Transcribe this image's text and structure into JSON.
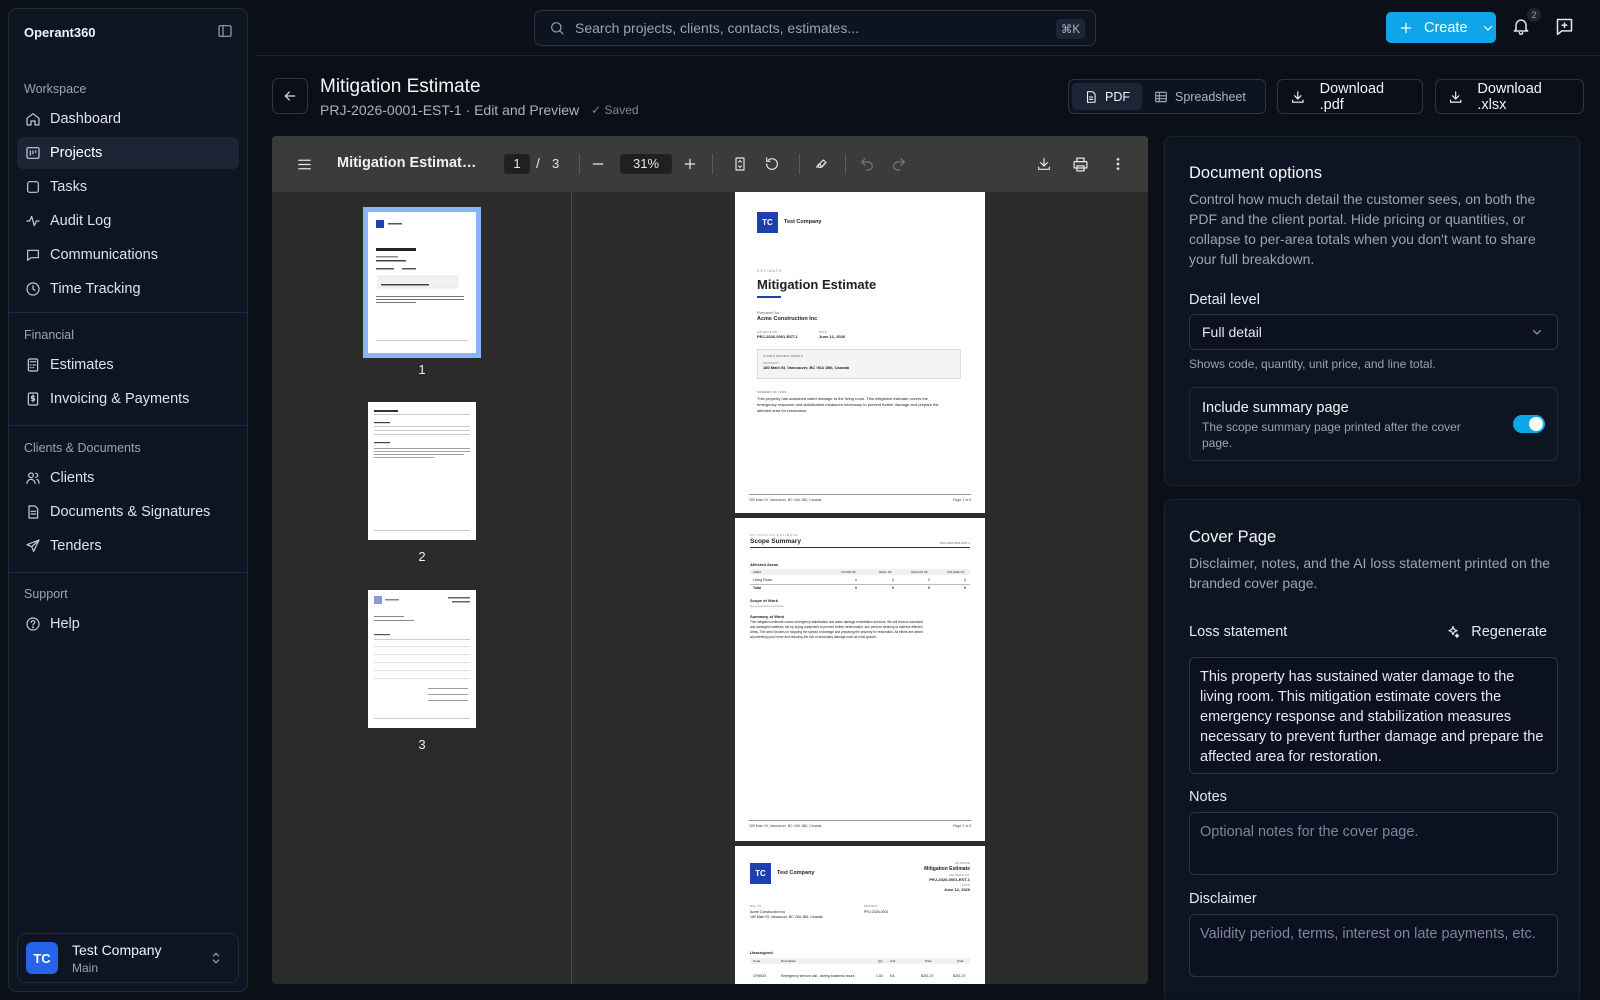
{
  "brand": "Operant360",
  "sidebar": {
    "groups": [
      {
        "title": "Workspace",
        "items": [
          {
            "label": "Dashboard",
            "icon": "home-icon"
          },
          {
            "label": "Projects",
            "icon": "projects-icon",
            "active": true
          },
          {
            "label": "Tasks",
            "icon": "tasks-icon"
          },
          {
            "label": "Audit Log",
            "icon": "activity-icon"
          },
          {
            "label": "Communications",
            "icon": "message-icon"
          },
          {
            "label": "Time Tracking",
            "icon": "clock-icon"
          }
        ]
      },
      {
        "title": "Financial",
        "items": [
          {
            "label": "Estimates",
            "icon": "calculator-icon"
          },
          {
            "label": "Invoicing & Payments",
            "icon": "receipt-icon"
          }
        ]
      },
      {
        "title": "Clients & Documents",
        "items": [
          {
            "label": "Clients",
            "icon": "users-icon"
          },
          {
            "label": "Documents & Signatures",
            "icon": "document-icon"
          },
          {
            "label": "Tenders",
            "icon": "send-icon"
          }
        ]
      },
      {
        "title": "Support",
        "items": [
          {
            "label": "Help",
            "icon": "help-icon"
          }
        ]
      }
    ],
    "user": {
      "initials": "TC",
      "name": "Test Company",
      "sub": "Main"
    }
  },
  "topbar": {
    "search_placeholder": "Search projects, clients, contacts, estimates...",
    "shortcut": "⌘K",
    "create_label": "Create",
    "notification_count": "2"
  },
  "header": {
    "title": "Mitigation Estimate",
    "subtitle": "PRJ-2026-0001-EST-1 · Edit and Preview",
    "saved": "Saved",
    "view_toggle": {
      "pdf": "PDF",
      "spreadsheet": "Spreadsheet"
    },
    "download_pdf": "Download .pdf",
    "download_xlsx": "Download .xlsx"
  },
  "viewer": {
    "doc_title": "Mitigation Estimate ...",
    "page_current": "1",
    "page_sep": "/",
    "page_total": "3",
    "zoom": "31%",
    "thumb_numbers": [
      "1",
      "2",
      "3"
    ]
  },
  "pdf": {
    "company": "Test Company",
    "logo": "TC",
    "p1": {
      "kicker": "ESTIMATE",
      "title": "Mitigation Estimate",
      "prepared_for_label": "Prepared for",
      "client": "Acme Construction Inc",
      "est_no_label": "ESTIMATE NO.",
      "est_no": "PRJ-2026-0001-EST-1",
      "date_label": "DATE",
      "date": "June 12, 2026",
      "claim_label": "CLAIM & PROJECT DETAILS",
      "property_label": "PROPERTY",
      "property": "180 Main St, Vancouver, BC V6A 1B6, Canada",
      "summary_label": "SUMMARY OF LOSS",
      "summary_lines": [
        "This property has sustained water damage to the living room. This mitigation estimate covers the",
        "emergency response and stabilization measures necessary to prevent further damage and prepare the",
        "affected area for restoration."
      ],
      "footer_addr": "180 Main St, Vancouver, BC V6A 1B6, Canada",
      "footer_page": "Page 1 of 3"
    },
    "p2": {
      "kicker": "MITIGATION ESTIMATE",
      "title": "Scope Summary",
      "ref": "PRJ-2026-0001-EST-1",
      "areas_title": "Affected Areas",
      "cols": [
        "AREA",
        "FLOOR SF",
        "WALL SF",
        "CEILING SF",
        "VOLUME CF"
      ],
      "rows": [
        [
          "Living Room",
          "0",
          "0",
          "0",
          "0"
        ],
        [
          "Total",
          "0",
          "0",
          "0",
          "0"
        ]
      ],
      "scope_title": "Scope of Work",
      "scope_note": "No scope items recorded.",
      "sow_title": "Summary of Work",
      "sow_lines": [
        "This mitigation estimate covers emergency stabilization and water damage remediation services. We will remove saturated",
        "and damaged materials, set up drying equipment to prevent further deterioration, and perform cleaning to address affected",
        "areas. The work focuses on stopping the spread of damage and preparing the property for restoration. All efforts are aimed",
        "at protecting your home and reducing the risk of secondary damage such as mold growth."
      ],
      "footer_page": "Page 2 of 3"
    },
    "p3": {
      "doc_kind": "ESTIMATE",
      "title": "Mitigation Estimate",
      "est_no_label": "ESTIMATE NO.",
      "est_no": "PRJ-2026-0001-EST-1",
      "date_label": "DATE",
      "date": "June 12, 2026",
      "bill_to_label": "BILL TO",
      "bill_to_name": "Acme Construction Inc",
      "bill_to_addr": "180 Main St, Vancouver, BC V6A 1B6, Canada",
      "project_label": "PROJECT",
      "project": "PRJ-2026-0001",
      "section": "Unassigned",
      "cols": [
        "Code",
        "Description",
        "Qty",
        "Unit",
        "Price",
        "Total"
      ],
      "first_row": [
        "CFWDD",
        "Emergency service call - during business hours",
        "1.00",
        "EA",
        "$201.07",
        "$201.07"
      ]
    }
  },
  "document_options": {
    "title": "Document options",
    "desc": "Control how much detail the customer sees, on both the PDF and the client portal. Hide pricing or quantities, or collapse to per-area totals when you don't want to share your full breakdown.",
    "detail_label": "Detail level",
    "detail_value": "Full detail",
    "detail_hint": "Shows code, quantity, unit price, and line total.",
    "summary_title": "Include summary page",
    "summary_desc": "The scope summary page printed after the cover page.",
    "summary_on": true
  },
  "cover_page": {
    "title": "Cover Page",
    "desc": "Disclaimer, notes, and the AI loss statement printed on the branded cover page.",
    "loss_label": "Loss statement",
    "regenerate": "Regenerate",
    "loss_text": "This property has sustained water damage to the living room. This mitigation estimate covers the emergency response and stabilization measures necessary to prevent further damage and prepare the affected area for restoration.",
    "notes_label": "Notes",
    "notes_placeholder": "Optional notes for the cover page.",
    "disclaimer_label": "Disclaimer",
    "disclaimer_placeholder": "Validity period, terms, interest on late payments, etc."
  },
  "colors": {
    "accent": "#0ea5e9",
    "avatar": "#2563eb",
    "background": "#0b1018"
  }
}
